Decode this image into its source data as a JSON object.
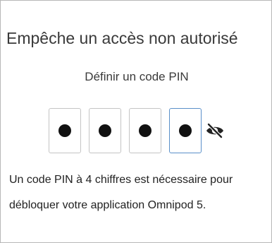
{
  "screen": {
    "title": "Empêche un accès non autorisé",
    "subtitle": "Définir un code PIN",
    "pin": {
      "digits": [
        "●",
        "●",
        "●",
        "●"
      ],
      "active_index": 3,
      "visibility_icon": "eye-slash-icon"
    },
    "description": "Un code PIN à 4 chiffres est nécessaire pour débloquer votre application Omnipod 5."
  },
  "colors": {
    "active_border": "#5a8fc9",
    "box_border": "#c4c4c4"
  }
}
